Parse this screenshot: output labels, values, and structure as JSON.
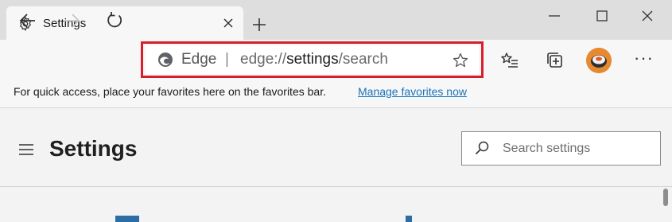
{
  "tab": {
    "title": "Settings",
    "icon": "gear-icon"
  },
  "window": {
    "min_icon": "minimize-icon",
    "max_icon": "maximize-icon",
    "close_icon": "close-icon"
  },
  "toolbar": {
    "address": {
      "brand": "Edge",
      "separator": "|",
      "url_prefix": "edge://",
      "url_strong": "settings",
      "url_suffix": "/search"
    },
    "more": "···"
  },
  "favbar": {
    "text": "For quick access, place your favorites here on the favorites bar.",
    "link": "Manage favorites now"
  },
  "settings": {
    "title": "Settings",
    "search_placeholder": "Search settings"
  },
  "colors": {
    "highlight": "#d81e2a",
    "link": "#1a73b8"
  }
}
